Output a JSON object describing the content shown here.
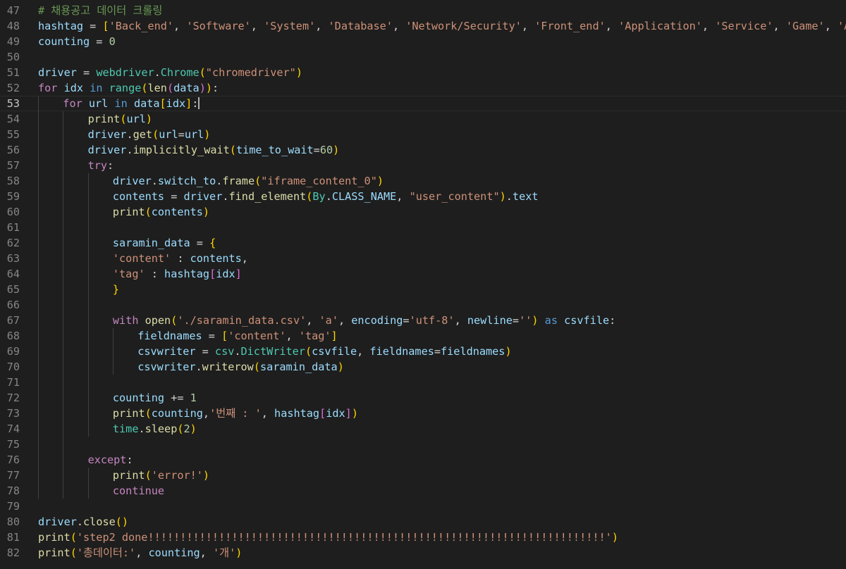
{
  "editor": {
    "theme_background": "#1e1e1e",
    "current_line": 53,
    "lines": [
      {
        "n": "47",
        "i": 0,
        "t": [
          [
            "cm",
            "# 채용공고 데이터 크롤링"
          ]
        ]
      },
      {
        "n": "48",
        "i": 0,
        "t": [
          [
            "vr",
            "hashtag"
          ],
          [
            "op",
            " = "
          ],
          [
            "k1",
            "["
          ],
          [
            "st",
            "'Back_end'"
          ],
          [
            "op",
            ", "
          ],
          [
            "st",
            "'Software'"
          ],
          [
            "op",
            ", "
          ],
          [
            "st",
            "'System'"
          ],
          [
            "op",
            ", "
          ],
          [
            "st",
            "'Database'"
          ],
          [
            "op",
            ", "
          ],
          [
            "st",
            "'Network/Security'"
          ],
          [
            "op",
            ", "
          ],
          [
            "st",
            "'Front_end'"
          ],
          [
            "op",
            ", "
          ],
          [
            "st",
            "'Application'"
          ],
          [
            "op",
            ", "
          ],
          [
            "st",
            "'Service'"
          ],
          [
            "op",
            ", "
          ],
          [
            "st",
            "'Game'"
          ],
          [
            "op",
            ", "
          ],
          [
            "st",
            "'AI'"
          ],
          [
            "k1",
            "]"
          ]
        ]
      },
      {
        "n": "49",
        "i": 0,
        "t": [
          [
            "vr",
            "counting"
          ],
          [
            "op",
            " = "
          ],
          [
            "nu",
            "0"
          ]
        ]
      },
      {
        "n": "50",
        "i": 0,
        "t": []
      },
      {
        "n": "51",
        "i": 0,
        "t": [
          [
            "vr",
            "driver"
          ],
          [
            "op",
            " = "
          ],
          [
            "cl",
            "webdriver"
          ],
          [
            "op",
            "."
          ],
          [
            "cl",
            "Chrome"
          ],
          [
            "k1",
            "("
          ],
          [
            "st",
            "\"chromedriver\""
          ],
          [
            "k1",
            ")"
          ]
        ]
      },
      {
        "n": "52",
        "i": 0,
        "t": [
          [
            "kw",
            "for"
          ],
          [
            "op",
            " "
          ],
          [
            "vr",
            "idx"
          ],
          [
            "op",
            " "
          ],
          [
            "kb",
            "in"
          ],
          [
            "op",
            " "
          ],
          [
            "cl",
            "range"
          ],
          [
            "k1",
            "("
          ],
          [
            "fn",
            "len"
          ],
          [
            "k2",
            "("
          ],
          [
            "vr",
            "data"
          ],
          [
            "k2",
            ")"
          ],
          [
            "k1",
            ")"
          ],
          [
            "op",
            ":"
          ]
        ]
      },
      {
        "n": "53",
        "i": 1,
        "t": [
          [
            "kw",
            "for"
          ],
          [
            "op",
            " "
          ],
          [
            "vr",
            "url"
          ],
          [
            "op",
            " "
          ],
          [
            "kb",
            "in"
          ],
          [
            "op",
            " "
          ],
          [
            "vr",
            "data"
          ],
          [
            "k1",
            "["
          ],
          [
            "vr",
            "idx"
          ],
          [
            "k1",
            "]"
          ],
          [
            "op",
            ":"
          ]
        ],
        "cursor": true
      },
      {
        "n": "54",
        "i": 2,
        "t": [
          [
            "fn",
            "print"
          ],
          [
            "k1",
            "("
          ],
          [
            "vr",
            "url"
          ],
          [
            "k1",
            ")"
          ]
        ]
      },
      {
        "n": "55",
        "i": 2,
        "t": [
          [
            "vr",
            "driver"
          ],
          [
            "op",
            "."
          ],
          [
            "fn",
            "get"
          ],
          [
            "k1",
            "("
          ],
          [
            "vr",
            "url"
          ],
          [
            "op",
            "="
          ],
          [
            "vr",
            "url"
          ],
          [
            "k1",
            ")"
          ]
        ]
      },
      {
        "n": "56",
        "i": 2,
        "t": [
          [
            "vr",
            "driver"
          ],
          [
            "op",
            "."
          ],
          [
            "fn",
            "implicitly_wait"
          ],
          [
            "k1",
            "("
          ],
          [
            "vr",
            "time_to_wait"
          ],
          [
            "op",
            "="
          ],
          [
            "nu",
            "60"
          ],
          [
            "k1",
            ")"
          ]
        ]
      },
      {
        "n": "57",
        "i": 2,
        "t": [
          [
            "kw",
            "try"
          ],
          [
            "op",
            ":"
          ]
        ]
      },
      {
        "n": "58",
        "i": 3,
        "t": [
          [
            "vr",
            "driver"
          ],
          [
            "op",
            "."
          ],
          [
            "vr",
            "switch_to"
          ],
          [
            "op",
            "."
          ],
          [
            "fn",
            "frame"
          ],
          [
            "k1",
            "("
          ],
          [
            "st",
            "\"iframe_content_0\""
          ],
          [
            "k1",
            ")"
          ]
        ]
      },
      {
        "n": "59",
        "i": 3,
        "t": [
          [
            "vr",
            "contents"
          ],
          [
            "op",
            " = "
          ],
          [
            "vr",
            "driver"
          ],
          [
            "op",
            "."
          ],
          [
            "fn",
            "find_element"
          ],
          [
            "k1",
            "("
          ],
          [
            "cl",
            "By"
          ],
          [
            "op",
            "."
          ],
          [
            "vr",
            "CLASS_NAME"
          ],
          [
            "op",
            ", "
          ],
          [
            "st",
            "\"user_content\""
          ],
          [
            "k1",
            ")"
          ],
          [
            "op",
            "."
          ],
          [
            "vr",
            "text"
          ]
        ]
      },
      {
        "n": "60",
        "i": 3,
        "t": [
          [
            "fn",
            "print"
          ],
          [
            "k1",
            "("
          ],
          [
            "vr",
            "contents"
          ],
          [
            "k1",
            ")"
          ]
        ]
      },
      {
        "n": "61",
        "i": 3,
        "t": []
      },
      {
        "n": "62",
        "i": 3,
        "t": [
          [
            "vr",
            "saramin_data"
          ],
          [
            "op",
            " = "
          ],
          [
            "k1",
            "{"
          ]
        ]
      },
      {
        "n": "63",
        "i": 3,
        "t": [
          [
            "st",
            "'content'"
          ],
          [
            "op",
            " : "
          ],
          [
            "vr",
            "contents"
          ],
          [
            "op",
            ","
          ]
        ]
      },
      {
        "n": "64",
        "i": 3,
        "t": [
          [
            "st",
            "'tag'"
          ],
          [
            "op",
            " : "
          ],
          [
            "vr",
            "hashtag"
          ],
          [
            "k2",
            "["
          ],
          [
            "vr",
            "idx"
          ],
          [
            "k2",
            "]"
          ]
        ]
      },
      {
        "n": "65",
        "i": 3,
        "t": [
          [
            "k1",
            "}"
          ]
        ]
      },
      {
        "n": "66",
        "i": 3,
        "t": []
      },
      {
        "n": "67",
        "i": 3,
        "t": [
          [
            "kw",
            "with"
          ],
          [
            "op",
            " "
          ],
          [
            "fn",
            "open"
          ],
          [
            "k1",
            "("
          ],
          [
            "st",
            "'./saramin_data.csv'"
          ],
          [
            "op",
            ", "
          ],
          [
            "st",
            "'a'"
          ],
          [
            "op",
            ", "
          ],
          [
            "vr",
            "encoding"
          ],
          [
            "op",
            "="
          ],
          [
            "st",
            "'utf-8'"
          ],
          [
            "op",
            ", "
          ],
          [
            "vr",
            "newline"
          ],
          [
            "op",
            "="
          ],
          [
            "st",
            "''"
          ],
          [
            "k1",
            ")"
          ],
          [
            "op",
            " "
          ],
          [
            "kb",
            "as"
          ],
          [
            "op",
            " "
          ],
          [
            "vr",
            "csvfile"
          ],
          [
            "op",
            ":"
          ]
        ]
      },
      {
        "n": "68",
        "i": 4,
        "t": [
          [
            "vr",
            "fieldnames"
          ],
          [
            "op",
            " = "
          ],
          [
            "k1",
            "["
          ],
          [
            "st",
            "'content'"
          ],
          [
            "op",
            ", "
          ],
          [
            "st",
            "'tag'"
          ],
          [
            "k1",
            "]"
          ]
        ]
      },
      {
        "n": "69",
        "i": 4,
        "t": [
          [
            "vr",
            "csvwriter"
          ],
          [
            "op",
            " = "
          ],
          [
            "cl",
            "csv"
          ],
          [
            "op",
            "."
          ],
          [
            "cl",
            "DictWriter"
          ],
          [
            "k1",
            "("
          ],
          [
            "vr",
            "csvfile"
          ],
          [
            "op",
            ", "
          ],
          [
            "vr",
            "fieldnames"
          ],
          [
            "op",
            "="
          ],
          [
            "vr",
            "fieldnames"
          ],
          [
            "k1",
            ")"
          ]
        ]
      },
      {
        "n": "70",
        "i": 4,
        "t": [
          [
            "vr",
            "csvwriter"
          ],
          [
            "op",
            "."
          ],
          [
            "fn",
            "writerow"
          ],
          [
            "k1",
            "("
          ],
          [
            "vr",
            "saramin_data"
          ],
          [
            "k1",
            ")"
          ]
        ]
      },
      {
        "n": "71",
        "i": 3,
        "t": []
      },
      {
        "n": "72",
        "i": 3,
        "t": [
          [
            "vr",
            "counting"
          ],
          [
            "op",
            " += "
          ],
          [
            "nu",
            "1"
          ]
        ]
      },
      {
        "n": "73",
        "i": 3,
        "t": [
          [
            "fn",
            "print"
          ],
          [
            "k1",
            "("
          ],
          [
            "vr",
            "counting"
          ],
          [
            "op",
            ","
          ],
          [
            "st",
            "'번째 : '"
          ],
          [
            "op",
            ", "
          ],
          [
            "vr",
            "hashtag"
          ],
          [
            "k2",
            "["
          ],
          [
            "vr",
            "idx"
          ],
          [
            "k2",
            "]"
          ],
          [
            "k1",
            ")"
          ]
        ]
      },
      {
        "n": "74",
        "i": 3,
        "t": [
          [
            "cl",
            "time"
          ],
          [
            "op",
            "."
          ],
          [
            "fn",
            "sleep"
          ],
          [
            "k1",
            "("
          ],
          [
            "nu",
            "2"
          ],
          [
            "k1",
            ")"
          ]
        ]
      },
      {
        "n": "75",
        "i": 2,
        "t": []
      },
      {
        "n": "76",
        "i": 2,
        "t": [
          [
            "kw",
            "except"
          ],
          [
            "op",
            ":"
          ]
        ]
      },
      {
        "n": "77",
        "i": 3,
        "t": [
          [
            "fn",
            "print"
          ],
          [
            "k1",
            "("
          ],
          [
            "st",
            "'error!'"
          ],
          [
            "k1",
            ")"
          ]
        ]
      },
      {
        "n": "78",
        "i": 3,
        "t": [
          [
            "kw",
            "continue"
          ]
        ]
      },
      {
        "n": "79",
        "i": 0,
        "t": []
      },
      {
        "n": "80",
        "i": 0,
        "t": [
          [
            "vr",
            "driver"
          ],
          [
            "op",
            "."
          ],
          [
            "fn",
            "close"
          ],
          [
            "k1",
            "("
          ],
          [
            "k1",
            ")"
          ]
        ]
      },
      {
        "n": "81",
        "i": 0,
        "t": [
          [
            "fn",
            "print"
          ],
          [
            "k1",
            "("
          ],
          [
            "st",
            "'step2 done!!!!!!!!!!!!!!!!!!!!!!!!!!!!!!!!!!!!!!!!!!!!!!!!!!!!!!!!!!!!!!!!!!!!!!!'"
          ],
          [
            "k1",
            ")"
          ]
        ]
      },
      {
        "n": "82",
        "i": 0,
        "t": [
          [
            "fn",
            "print"
          ],
          [
            "k1",
            "("
          ],
          [
            "st",
            "'총데이터:'"
          ],
          [
            "op",
            ", "
          ],
          [
            "vr",
            "counting"
          ],
          [
            "op",
            ", "
          ],
          [
            "st",
            "'개'"
          ],
          [
            "k1",
            ")"
          ]
        ]
      }
    ]
  }
}
